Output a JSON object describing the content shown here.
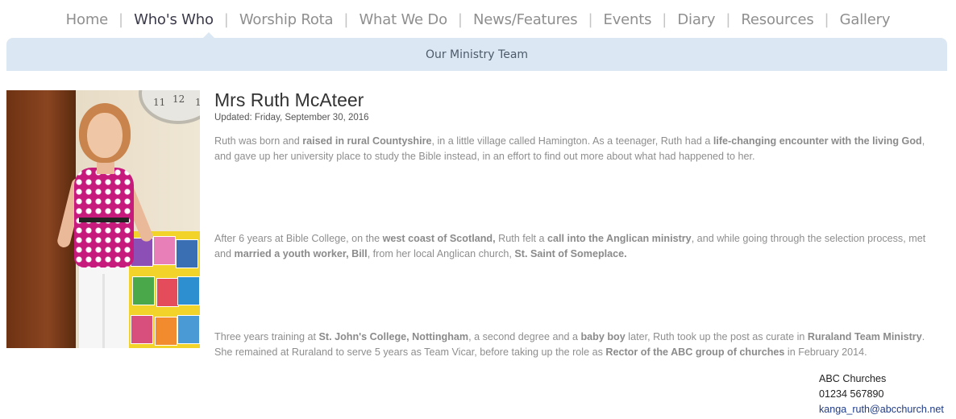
{
  "nav": {
    "items": [
      {
        "label": "Home"
      },
      {
        "label": "Who's Who",
        "active": true
      },
      {
        "label": "Worship Rota"
      },
      {
        "label": "What We Do"
      },
      {
        "label": "News/Features"
      },
      {
        "label": "Events"
      },
      {
        "label": "Diary"
      },
      {
        "label": "Resources"
      },
      {
        "label": "Gallery"
      }
    ],
    "separator": "|"
  },
  "subnav": {
    "link": "Our Ministry Team"
  },
  "photo": {
    "clock_numbers": [
      "12",
      "11",
      "1"
    ]
  },
  "article": {
    "title": "Mrs Ruth McAteer",
    "updated": "Updated: Friday, September 30, 2016",
    "paragraphs": [
      [
        {
          "t": "Ruth was born and "
        },
        {
          "t": "raised in rural Countyshire",
          "b": true
        },
        {
          "t": ", in a little village called Hamington.  As a teenager, Ruth had a "
        },
        {
          "t": "life-changing encounter with the living God",
          "b": true
        },
        {
          "t": ", and gave up her university place to study the Bible instead, in an effort to find out more about what had happened to her."
        }
      ],
      [
        {
          "t": "After 6 years at Bible College, on the "
        },
        {
          "t": "west coast of Scotland,",
          "b": true
        },
        {
          "t": " Ruth felt a "
        },
        {
          "t": "call into the Anglican ministry",
          "b": true
        },
        {
          "t": ", and while going through the selection process, met and "
        },
        {
          "t": "married a youth worker, Bill",
          "b": true
        },
        {
          "t": ", from her local Anglican church, "
        },
        {
          "t": " St. Saint of Someplace.",
          "b": true
        }
      ],
      [
        {
          "t": "Three years training at "
        },
        {
          "t": "St. John's College, Nottingham",
          "b": true
        },
        {
          "t": ", a second degree and a "
        },
        {
          "t": "baby boy",
          "b": true
        },
        {
          "t": " later, Ruth took up the post as curate in "
        },
        {
          "t": "Ruraland Team Ministry",
          "b": true
        },
        {
          "t": ".  She remained at Ruraland to serve 5 years as Team Vicar, before taking up the role as "
        },
        {
          "t": "Rector of the ABC group of churches",
          "b": true
        },
        {
          "t": " in February 2014."
        }
      ]
    ]
  },
  "contact": {
    "org": "ABC Churches",
    "phone": "01234 567890",
    "email": "kanga_ruth@abcchurch.net"
  }
}
